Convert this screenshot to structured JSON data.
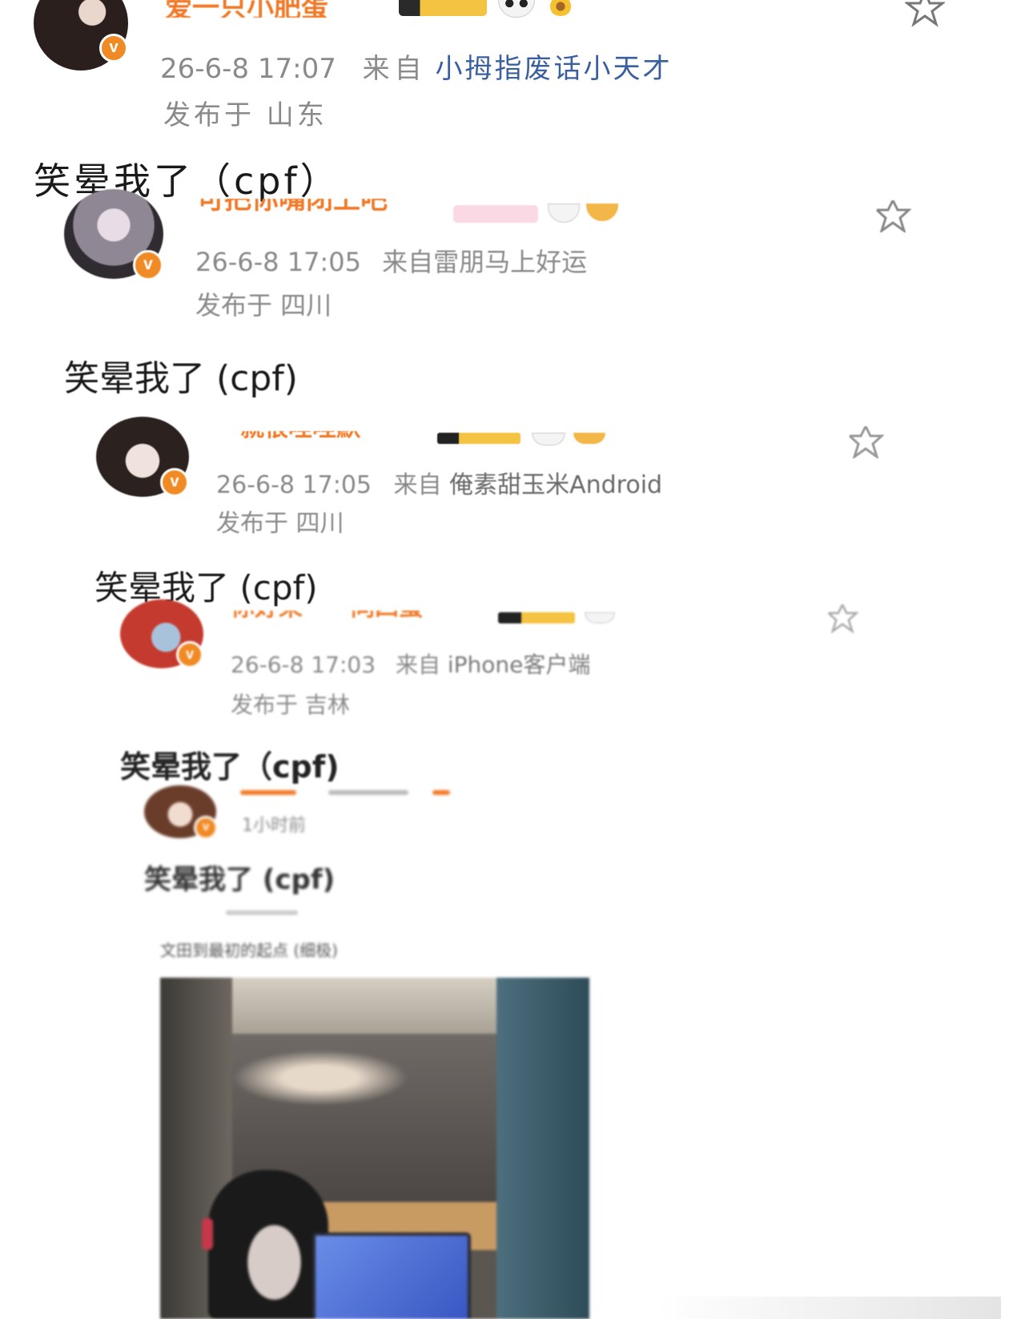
{
  "posts": [
    {
      "username": "爱一只小肥蛋",
      "time": "26-6-8 17:07",
      "from_prefix": "来自",
      "source": "小拇指废话小天才",
      "location": "发布于 山东",
      "text": "笑晕我了（cpf）"
    },
    {
      "username": "可把你嘴闭上吧",
      "time": "26-6-8 17:05",
      "from_prefix": "来自",
      "source": "雷朋马上好运",
      "location": "发布于 四川",
      "text": "笑晕我了 (cpf)"
    },
    {
      "username": "一就很哇哇默",
      "time": "26-6-8 17:05",
      "from_prefix": "来自",
      "source": "俺素甜玉米Android",
      "location": "发布于 四川",
      "text": "笑晕我了 (cpf)"
    },
    {
      "username": "你好呆　一同四蛋",
      "time": "26-6-8 17:03",
      "from_prefix": "来自",
      "source": "iPhone客户端",
      "location": "发布于 吉林",
      "text": "笑晕我了（cpf)"
    },
    {
      "username": "",
      "time": "1小时前",
      "text": "笑晕我了 (cpf)",
      "sub_text": "文田到最初的起点 (细极)"
    }
  ],
  "badge_letter": "v",
  "colors": {
    "username": "#f07a28",
    "badge": "#f08a24",
    "source_link": "#3a5fa0",
    "meta": "#8a8a8a"
  }
}
